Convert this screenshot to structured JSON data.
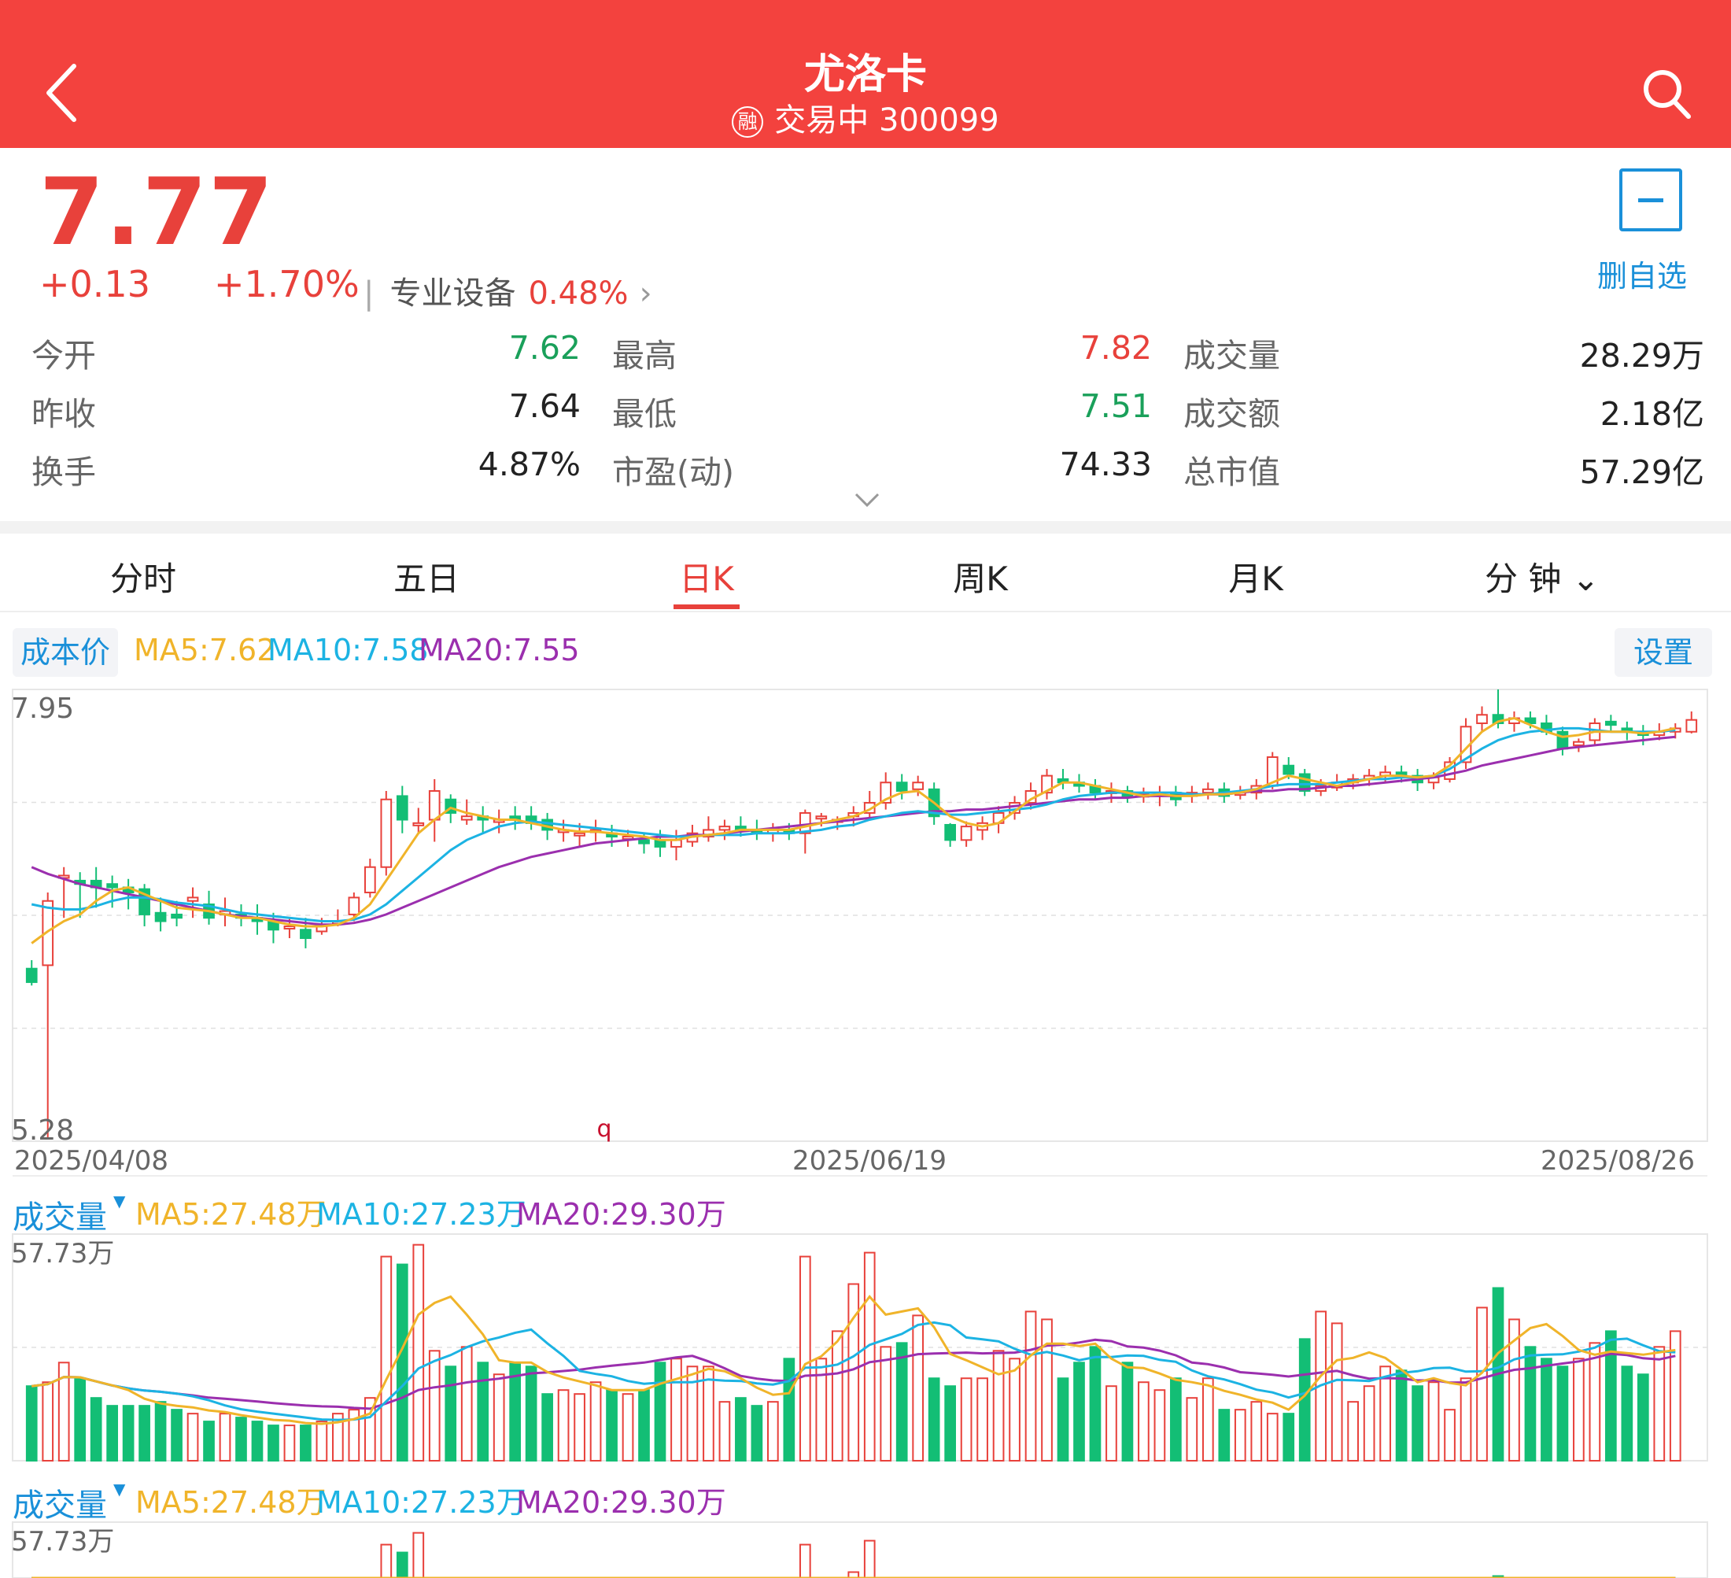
{
  "header": {
    "title": "尤洛卡",
    "rong_badge": "融",
    "status": "交易中 300099"
  },
  "quote": {
    "price": "7.77",
    "change": "+0.13",
    "change_pct": "+1.70%",
    "sector": "专业设备",
    "sector_pct": "0.48%",
    "delete_label": "删自选"
  },
  "stats": [
    {
      "label": "今开",
      "value": "7.62",
      "color": "#1aa05a"
    },
    {
      "label": "最高",
      "value": "7.82",
      "color": "#e8413b"
    },
    {
      "label": "成交量",
      "value": "28.29万",
      "color": "#222"
    },
    {
      "label": "昨收",
      "value": "7.64",
      "color": "#222"
    },
    {
      "label": "最低",
      "value": "7.51",
      "color": "#1aa05a"
    },
    {
      "label": "成交额",
      "value": "2.18亿",
      "color": "#222"
    },
    {
      "label": "换手",
      "value": "4.87%",
      "color": "#222"
    },
    {
      "label": "市盈(动)",
      "value": "74.33",
      "color": "#222"
    },
    {
      "label": "总市值",
      "value": "57.29亿",
      "color": "#222"
    }
  ],
  "tabs": [
    "分时",
    "五日",
    "日K",
    "周K",
    "月K",
    "分 钟"
  ],
  "active_tab": "日K",
  "kline": {
    "cost_label": "成本价",
    "ma5": "MA5:7.62",
    "ma10": "MA10:7.58",
    "ma20": "MA20:7.55",
    "settings_label": "设置",
    "y_max": "7.95",
    "y_min": "5.28",
    "marker": "q",
    "dates": [
      "2025/04/08",
      "2025/06/19",
      "2025/08/26"
    ]
  },
  "volume": {
    "label": "成交量",
    "ma5": "MA5:27.48万",
    "ma10": "MA10:27.23万",
    "ma20": "MA20:29.30万",
    "y_max": "57.73万"
  },
  "colors": {
    "up": "#e8413b",
    "down": "#13be75",
    "ma5": "#f0b42a",
    "ma10": "#1cb3e3",
    "ma20": "#9b2fae",
    "brand": "#f3423e",
    "link": "#1a90d9"
  },
  "icons": [
    "back-icon",
    "search-icon",
    "minus-icon",
    "chevron-right-icon",
    "chevron-down-icon",
    "triangle-down-icon"
  ],
  "chart_data": [
    {
      "type": "candlestick",
      "y_range": [
        5.28,
        7.95
      ],
      "x_labels": [
        "2025/04/08",
        "2025/06/19",
        "2025/08/26"
      ],
      "candles": [
        [
          6.3,
          6.22,
          6.35,
          6.2
        ],
        [
          6.32,
          6.7,
          6.75,
          5.3
        ],
        [
          6.85,
          6.85,
          6.9,
          6.6
        ],
        [
          6.82,
          6.8,
          6.87,
          6.6
        ],
        [
          6.82,
          6.78,
          6.9,
          6.66
        ],
        [
          6.8,
          6.78,
          6.85,
          6.66
        ],
        [
          6.78,
          6.75,
          6.83,
          6.65
        ],
        [
          6.77,
          6.62,
          6.8,
          6.55
        ],
        [
          6.63,
          6.58,
          6.72,
          6.52
        ],
        [
          6.62,
          6.6,
          6.7,
          6.55
        ],
        [
          6.7,
          6.72,
          6.78,
          6.6
        ],
        [
          6.68,
          6.6,
          6.76,
          6.56
        ],
        [
          6.62,
          6.64,
          6.72,
          6.55
        ],
        [
          6.62,
          6.6,
          6.68,
          6.55
        ],
        [
          6.6,
          6.58,
          6.68,
          6.5
        ],
        [
          6.58,
          6.53,
          6.63,
          6.45
        ],
        [
          6.55,
          6.55,
          6.6,
          6.48
        ],
        [
          6.53,
          6.48,
          6.6,
          6.42
        ],
        [
          6.52,
          6.55,
          6.6,
          6.5
        ],
        [
          6.58,
          6.58,
          6.65,
          6.55
        ],
        [
          6.62,
          6.72,
          6.75,
          6.58
        ],
        [
          6.75,
          6.9,
          6.95,
          6.72
        ],
        [
          6.9,
          7.3,
          7.35,
          6.85
        ],
        [
          7.32,
          7.18,
          7.38,
          7.1
        ],
        [
          7.15,
          7.16,
          7.25,
          7.1
        ],
        [
          7.18,
          7.35,
          7.42,
          7.05
        ],
        [
          7.3,
          7.22,
          7.33,
          7.16
        ],
        [
          7.18,
          7.2,
          7.3,
          7.15
        ],
        [
          7.2,
          7.18,
          7.26,
          7.1
        ],
        [
          7.18,
          7.18,
          7.24,
          7.1
        ],
        [
          7.2,
          7.18,
          7.26,
          7.12
        ],
        [
          7.2,
          7.16,
          7.26,
          7.12
        ],
        [
          7.18,
          7.12,
          7.22,
          7.06
        ],
        [
          7.12,
          7.12,
          7.18,
          7.05
        ],
        [
          7.1,
          7.1,
          7.16,
          7.02
        ],
        [
          7.12,
          7.12,
          7.18,
          7.05
        ],
        [
          7.1,
          7.08,
          7.15,
          7.02
        ],
        [
          7.08,
          7.08,
          7.12,
          7.02
        ],
        [
          7.06,
          7.04,
          7.1,
          6.98
        ],
        [
          7.06,
          7.02,
          7.12,
          6.96
        ],
        [
          7.02,
          7.06,
          7.12,
          6.94
        ],
        [
          7.05,
          7.1,
          7.15,
          7.02
        ],
        [
          7.08,
          7.12,
          7.2,
          7.05
        ],
        [
          7.12,
          7.14,
          7.18,
          7.06
        ],
        [
          7.14,
          7.12,
          7.2,
          7.08
        ],
        [
          7.12,
          7.1,
          7.18,
          7.06
        ],
        [
          7.1,
          7.12,
          7.16,
          7.05
        ],
        [
          7.12,
          7.1,
          7.16,
          7.06
        ],
        [
          7.1,
          7.22,
          7.24,
          6.98
        ],
        [
          7.2,
          7.2,
          7.22,
          7.14
        ],
        [
          7.18,
          7.18,
          7.2,
          7.12
        ],
        [
          7.2,
          7.22,
          7.26,
          7.14
        ],
        [
          7.22,
          7.28,
          7.35,
          7.18
        ],
        [
          7.28,
          7.4,
          7.46,
          7.24
        ],
        [
          7.4,
          7.35,
          7.45,
          7.3
        ],
        [
          7.36,
          7.4,
          7.44,
          7.32
        ],
        [
          7.36,
          7.2,
          7.4,
          7.15
        ],
        [
          7.15,
          7.06,
          7.16,
          7.02
        ],
        [
          7.06,
          7.14,
          7.17,
          7.02
        ],
        [
          7.12,
          7.16,
          7.2,
          7.06
        ],
        [
          7.16,
          7.22,
          7.26,
          7.1
        ],
        [
          7.22,
          7.28,
          7.32,
          7.18
        ],
        [
          7.28,
          7.35,
          7.4,
          7.24
        ],
        [
          7.34,
          7.44,
          7.48,
          7.3
        ],
        [
          7.42,
          7.4,
          7.48,
          7.36
        ],
        [
          7.4,
          7.38,
          7.45,
          7.34
        ],
        [
          7.38,
          7.34,
          7.42,
          7.3
        ],
        [
          7.34,
          7.35,
          7.4,
          7.28
        ],
        [
          7.35,
          7.32,
          7.38,
          7.28
        ],
        [
          7.32,
          7.33,
          7.37,
          7.28
        ],
        [
          7.32,
          7.34,
          7.38,
          7.26
        ],
        [
          7.34,
          7.3,
          7.38,
          7.26
        ],
        [
          7.32,
          7.34,
          7.38,
          7.28
        ],
        [
          7.34,
          7.36,
          7.4,
          7.3
        ],
        [
          7.36,
          7.32,
          7.4,
          7.28
        ],
        [
          7.33,
          7.34,
          7.38,
          7.3
        ],
        [
          7.34,
          7.38,
          7.42,
          7.3
        ],
        [
          7.38,
          7.55,
          7.58,
          7.36
        ],
        [
          7.5,
          7.45,
          7.55,
          7.42
        ],
        [
          7.45,
          7.35,
          7.48,
          7.32
        ],
        [
          7.35,
          7.38,
          7.42,
          7.32
        ],
        [
          7.37,
          7.4,
          7.45,
          7.35
        ],
        [
          7.4,
          7.42,
          7.45,
          7.36
        ],
        [
          7.42,
          7.44,
          7.48,
          7.38
        ],
        [
          7.44,
          7.46,
          7.5,
          7.4
        ],
        [
          7.46,
          7.44,
          7.5,
          7.4
        ],
        [
          7.44,
          7.4,
          7.48,
          7.35
        ],
        [
          7.4,
          7.43,
          7.46,
          7.36
        ],
        [
          7.42,
          7.52,
          7.55,
          7.4
        ],
        [
          7.52,
          7.73,
          7.78,
          7.48
        ],
        [
          7.75,
          7.8,
          7.85,
          7.7
        ],
        [
          7.8,
          7.75,
          7.95,
          7.72
        ],
        [
          7.75,
          7.78,
          7.82,
          7.7
        ],
        [
          7.78,
          7.75,
          7.82,
          7.72
        ],
        [
          7.75,
          7.7,
          7.8,
          7.68
        ],
        [
          7.7,
          7.6,
          7.73,
          7.56
        ],
        [
          7.62,
          7.64,
          7.66,
          7.58
        ],
        [
          7.65,
          7.75,
          7.78,
          7.62
        ],
        [
          7.76,
          7.74,
          7.8,
          7.7
        ],
        [
          7.72,
          7.7,
          7.76,
          7.65
        ],
        [
          7.7,
          7.68,
          7.74,
          7.62
        ],
        [
          7.68,
          7.7,
          7.75,
          7.65
        ],
        [
          7.7,
          7.72,
          7.75,
          7.66
        ],
        [
          7.7,
          7.77,
          7.82,
          7.69
        ]
      ],
      "ma5": [
        6.45,
        6.52,
        6.58,
        6.62,
        6.7,
        6.76,
        6.78,
        6.74,
        6.7,
        6.66,
        6.65,
        6.64,
        6.62,
        6.6,
        6.6,
        6.58,
        6.56,
        6.55,
        6.55,
        6.56,
        6.6,
        6.68,
        6.82,
        6.96,
        7.1,
        7.18,
        7.25,
        7.22,
        7.2,
        7.18,
        7.18,
        7.16,
        7.14,
        7.12,
        7.11,
        7.11,
        7.1,
        7.09,
        7.08,
        7.06,
        7.06,
        7.08,
        7.09,
        7.1,
        7.12,
        7.12,
        7.12,
        7.12,
        7.14,
        7.16,
        7.18,
        7.2,
        7.24,
        7.3,
        7.34,
        7.35,
        7.28,
        7.2,
        7.16,
        7.14,
        7.16,
        7.23,
        7.3,
        7.35,
        7.4,
        7.4,
        7.38,
        7.36,
        7.34,
        7.32,
        7.33,
        7.32,
        7.32,
        7.33,
        7.33,
        7.34,
        7.36,
        7.4,
        7.44,
        7.42,
        7.4,
        7.38,
        7.4,
        7.42,
        7.44,
        7.44,
        7.43,
        7.44,
        7.5,
        7.6,
        7.7,
        7.76,
        7.78,
        7.74,
        7.7,
        7.67,
        7.68,
        7.7,
        7.7,
        7.7,
        7.69,
        7.7,
        7.72
      ],
      "ma10": [
        6.68,
        6.66,
        6.65,
        6.65,
        6.67,
        6.7,
        6.72,
        6.72,
        6.71,
        6.69,
        6.68,
        6.67,
        6.65,
        6.63,
        6.62,
        6.61,
        6.6,
        6.59,
        6.58,
        6.58,
        6.59,
        6.62,
        6.68,
        6.76,
        6.84,
        6.92,
        7.0,
        7.06,
        7.1,
        7.14,
        7.16,
        7.17,
        7.16,
        7.15,
        7.14,
        7.13,
        7.12,
        7.11,
        7.1,
        7.09,
        7.08,
        7.08,
        7.09,
        7.09,
        7.09,
        7.1,
        7.1,
        7.1,
        7.11,
        7.12,
        7.14,
        7.15,
        7.18,
        7.2,
        7.22,
        7.23,
        7.22,
        7.21,
        7.21,
        7.22,
        7.23,
        7.24,
        7.25,
        7.27,
        7.3,
        7.32,
        7.33,
        7.34,
        7.34,
        7.34,
        7.34,
        7.34,
        7.33,
        7.33,
        7.34,
        7.35,
        7.36,
        7.38,
        7.39,
        7.39,
        7.39,
        7.4,
        7.41,
        7.42,
        7.42,
        7.43,
        7.43,
        7.44,
        7.48,
        7.54,
        7.6,
        7.65,
        7.68,
        7.7,
        7.71,
        7.72,
        7.72,
        7.71,
        7.7,
        7.7,
        7.7,
        7.7,
        7.71
      ],
      "ma20": [
        6.9,
        6.86,
        6.83,
        6.8,
        6.78,
        6.76,
        6.74,
        6.72,
        6.7,
        6.68,
        6.66,
        6.64,
        6.62,
        6.61,
        6.6,
        6.59,
        6.58,
        6.57,
        6.56,
        6.56,
        6.57,
        6.59,
        6.62,
        6.66,
        6.7,
        6.74,
        6.78,
        6.82,
        6.86,
        6.9,
        6.93,
        6.96,
        6.98,
        7.0,
        7.02,
        7.04,
        7.05,
        7.06,
        7.07,
        7.08,
        7.08,
        7.09,
        7.09,
        7.1,
        7.11,
        7.12,
        7.13,
        7.14,
        7.15,
        7.16,
        7.17,
        7.18,
        7.19,
        7.2,
        7.21,
        7.22,
        7.23,
        7.23,
        7.24,
        7.24,
        7.25,
        7.26,
        7.27,
        7.28,
        7.29,
        7.3,
        7.3,
        7.31,
        7.31,
        7.32,
        7.32,
        7.32,
        7.33,
        7.33,
        7.33,
        7.34,
        7.35,
        7.35,
        7.36,
        7.36,
        7.37,
        7.38,
        7.38,
        7.39,
        7.4,
        7.41,
        7.42,
        7.43,
        7.45,
        7.47,
        7.5,
        7.52,
        7.54,
        7.56,
        7.58,
        7.6,
        7.61,
        7.62,
        7.63,
        7.64,
        7.65,
        7.66,
        7.67
      ]
    },
    {
      "type": "bar",
      "y_max": 57.73,
      "unit": "万",
      "volumes": [
        19,
        20,
        25,
        21,
        16,
        14,
        14,
        14,
        15,
        13,
        12,
        10,
        12,
        11,
        10,
        9,
        9,
        9,
        10,
        12,
        13,
        16,
        52,
        50,
        55,
        28,
        24,
        29,
        25,
        22,
        25,
        24,
        17,
        18,
        17,
        20,
        18,
        17,
        18,
        25,
        26,
        24,
        24,
        15,
        16,
        14,
        15,
        26,
        52,
        26,
        33,
        45,
        53,
        29,
        30,
        37,
        21,
        19,
        21,
        21,
        28,
        26,
        38,
        36,
        21,
        25,
        29,
        19,
        25,
        20,
        18,
        21,
        16,
        21,
        13,
        13,
        15,
        12,
        12,
        31,
        38,
        35,
        15,
        19,
        24,
        23,
        19,
        20,
        13,
        21,
        39,
        44,
        36,
        29,
        26,
        24,
        26,
        30,
        33,
        24,
        22,
        29,
        33
      ]
    }
  ]
}
